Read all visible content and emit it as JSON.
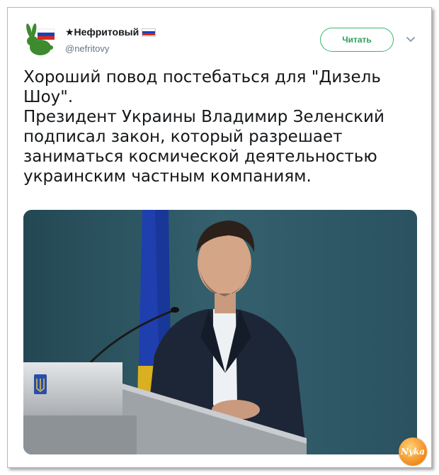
{
  "author": {
    "display_name": "★Нефритовый",
    "handle": "@nefritovy",
    "flag_colors": [
      "#ffffff",
      "#1c3fb8",
      "#d52b1e"
    ]
  },
  "actions": {
    "follow_label": "Читать",
    "more_icon": "chevron-down-icon"
  },
  "tweet": {
    "paragraphs": [
      "Хороший повод постебаться для \"Дизель Шоу\".",
      "Президент Украины Владимир Зеленский подписал закон, который разрешает заниматься космической деятельностью украинским частным компаниям."
    ]
  },
  "media": {
    "description_icon": "photo-president-podium"
  },
  "watermark": {
    "text": "Nyka"
  },
  "colors": {
    "accent": "#2e9e5b",
    "text": "#14171a",
    "muted": "#657786"
  }
}
